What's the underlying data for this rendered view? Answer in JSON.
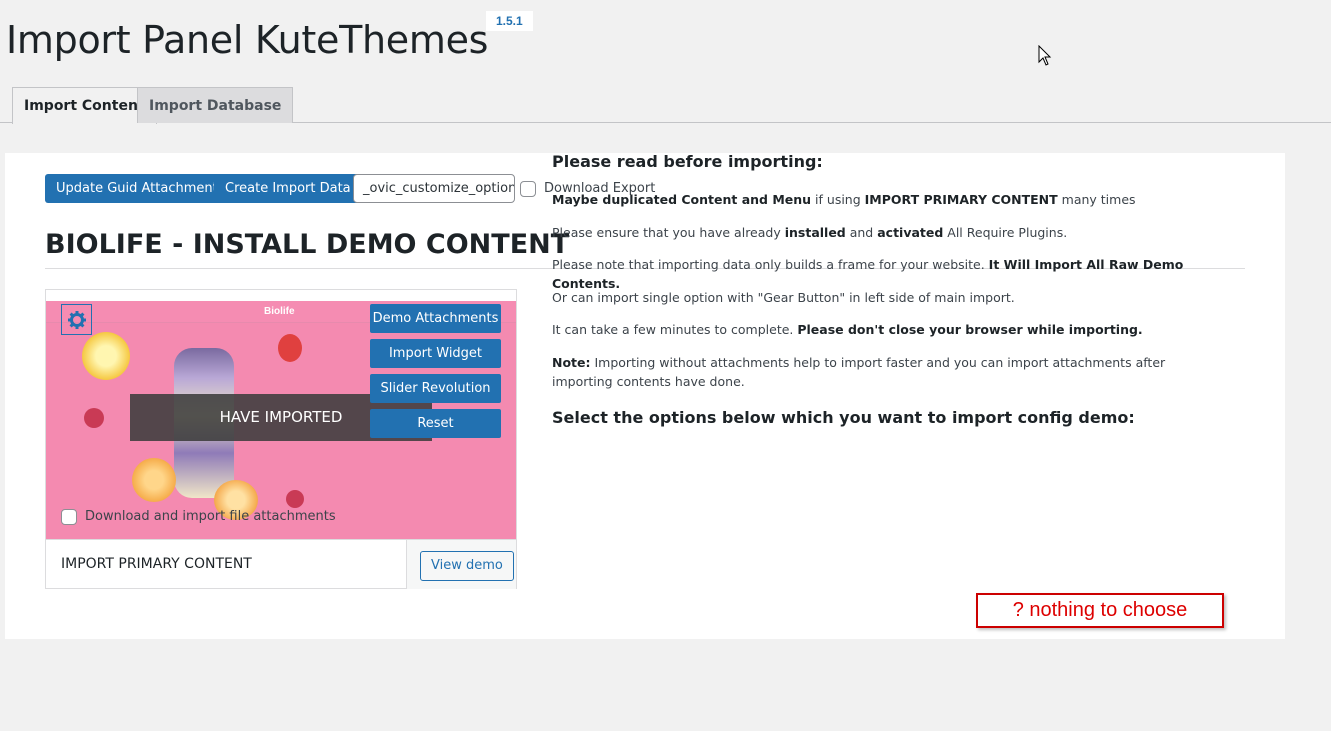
{
  "header": {
    "title": "Import Panel KuteThemes",
    "version": "1.5.1"
  },
  "tabs": [
    {
      "label": "Import Content",
      "active": true
    },
    {
      "label": "Import Database",
      "active": false
    }
  ],
  "toolbar": {
    "update_guid_label": "Update Guid Attachment",
    "create_import_label": "Create Import Data",
    "option_name_value": "_ovic_customize_option",
    "download_export_label": "Download Export",
    "download_export_checked": false
  },
  "section": {
    "title": "BIOLIFE - INSTALL DEMO CONTENT"
  },
  "demo_card": {
    "screenshot_logo": "Biolife",
    "status_overlay": "HAVE IMPORTED",
    "actions": [
      "Demo Attachments",
      "Import Widget",
      "Slider Revolution",
      "Reset"
    ],
    "attachments_label": "Download and import file attachments",
    "attachments_checked": false,
    "name": "IMPORT PRIMARY CONTENT",
    "view_demo_label": "View demo"
  },
  "info": {
    "heading": "Please read before importing:",
    "line1_bold": "Maybe duplicated Content and Menu",
    "line1_mid": " if using ",
    "line1_bold2": "IMPORT PRIMARY CONTENT",
    "line1_end": " many times",
    "line2_start": "Please ensure that you have already ",
    "line2_bold1": "installed",
    "line2_mid": " and ",
    "line2_bold2": "activated",
    "line2_end": " All Require Plugins.",
    "line3_start": "Please note that importing data only builds a frame for your website. ",
    "line3_bold": "It Will Import All Raw Demo Contents.",
    "line4": "Or can import single option with \"Gear Button\" in left side of main import.",
    "line5_start": "It can take a few minutes to complete. ",
    "line5_bold": "Please don't close your browser while importing.",
    "line6_bold": "Note:",
    "line6_rest": " Importing without attachments help to import faster and you can import attachments after importing contents have done.",
    "select_heading": "Select the options below which you want to import config demo:"
  },
  "annotation": "? nothing to choose",
  "colors": {
    "primary": "#2271b1",
    "demo_bg": "#f48ab0",
    "annotation_red": "#cc0000"
  }
}
